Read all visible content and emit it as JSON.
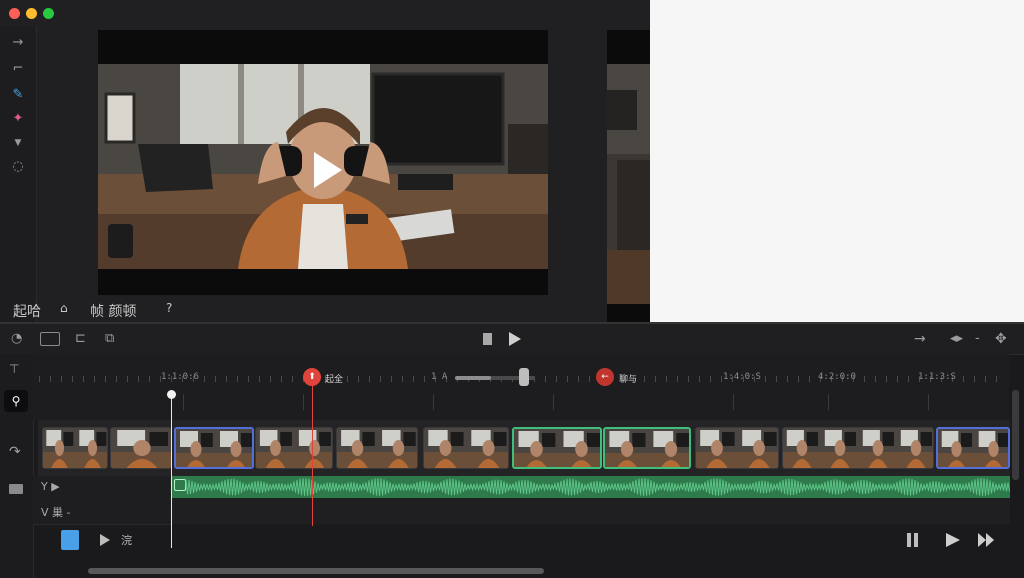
{
  "colors": {
    "accent_red": "#e0443a",
    "clip_blue": "#5470d8",
    "clip_green": "#3fbf7a",
    "audio_green": "#2f7a4b"
  },
  "window": {
    "traffic_lights": [
      "close",
      "minimize",
      "maximize"
    ]
  },
  "left_tools": [
    "arrow-right-icon",
    "crop-icon",
    "pen-icon",
    "effects-icon",
    "chevron-down-icon",
    "timer-icon"
  ],
  "info_bar": {
    "label_1": "起哈",
    "label_2": "帧 颜顿",
    "help": "?"
  },
  "ruler": {
    "timecodes": [
      "1:1:0:6",
      "1 A",
      "1:4:0:S",
      "4:2:0:0",
      "1:1:3:S"
    ],
    "marker_1_label": "起全",
    "marker_2_label": "聊与"
  },
  "zoom": {
    "value": 0.45
  },
  "tracks": {
    "video_head": "",
    "audio_head_1": "Y ▶",
    "audio_head_2": "V 巢 -"
  },
  "bottom_bar": {
    "label": "浣"
  }
}
